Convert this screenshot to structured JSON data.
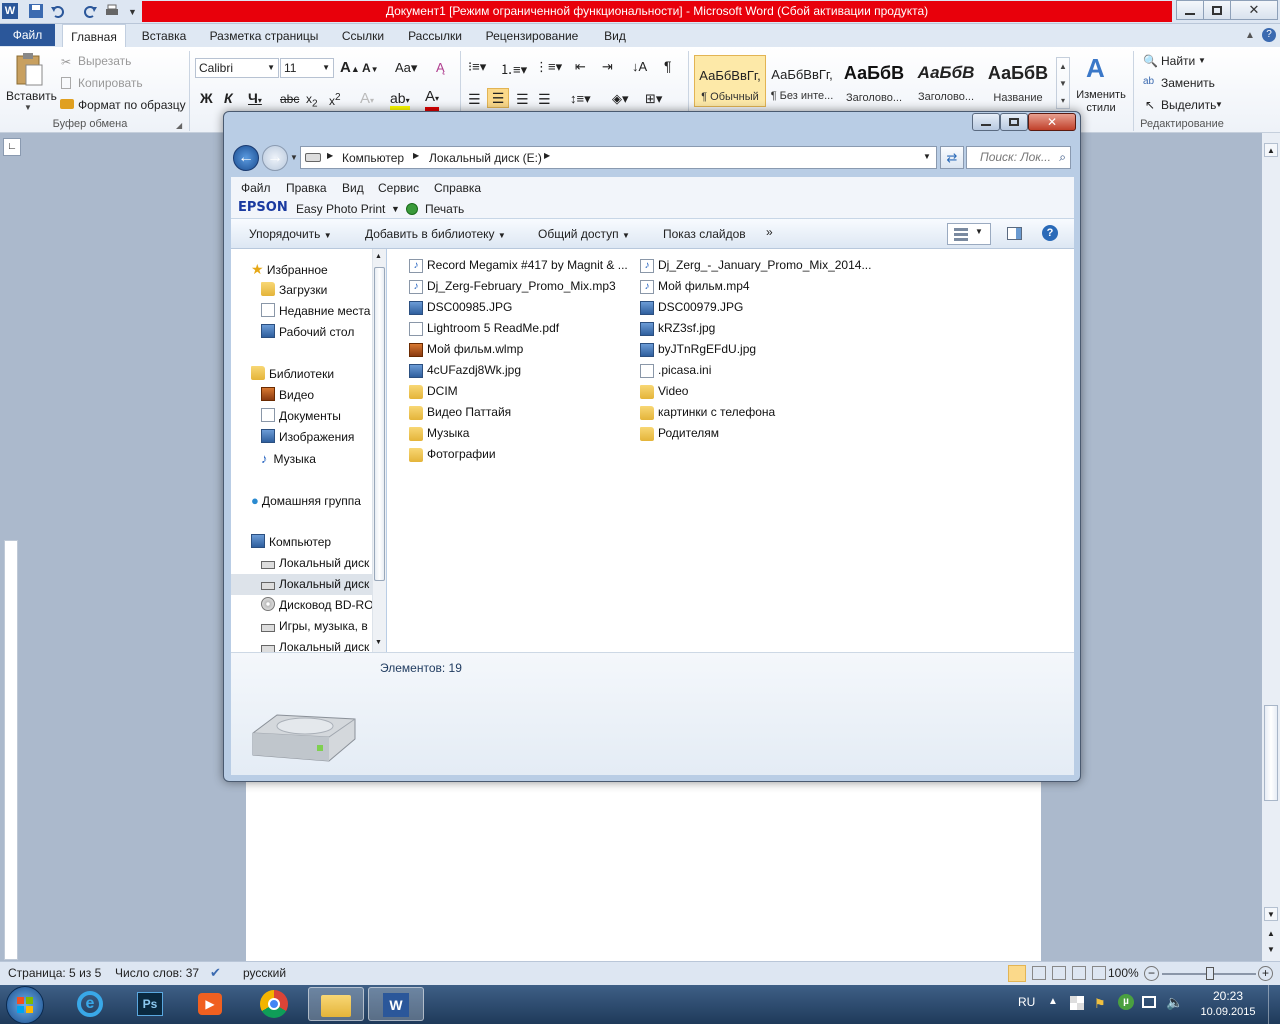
{
  "word": {
    "title": "Документ1 [Режим ограниченной функциональности]  -  Microsoft Word (Сбой активации продукта)",
    "tabs": [
      "Файл",
      "Главная",
      "Вставка",
      "Разметка страницы",
      "Ссылки",
      "Рассылки",
      "Рецензирование",
      "Вид"
    ],
    "ribbon": {
      "clipboard": {
        "paste": "Вставить",
        "cut": "Вырезать",
        "copy": "Копировать",
        "format_painter": "Формат по образцу",
        "group": "Буфер обмена"
      },
      "font": {
        "name": "Calibri",
        "size": "11"
      },
      "styles": [
        {
          "sample": "АаБбВвГг,",
          "name": "¶ Обычный"
        },
        {
          "sample": "АаБбВвГг,",
          "name": "¶ Без инте..."
        },
        {
          "sample": "АаБбВ",
          "name": "Заголово..."
        },
        {
          "sample": "АаБбВ",
          "name": "Заголово..."
        },
        {
          "sample": "АаБбВ",
          "name": "Название"
        }
      ],
      "change_styles": "Изменить стили",
      "editing": {
        "find": "Найти",
        "replace": "Заменить",
        "select": "Выделить",
        "group": "Редактирование"
      }
    },
    "status": {
      "page": "Страница: 5 из 5",
      "words": "Число слов: 37",
      "lang": "русский",
      "zoom": "100%"
    }
  },
  "explorer": {
    "breadcrumb": [
      "Компьютер",
      "Локальный диск (E:)"
    ],
    "search_placeholder": "Поиск: Лок...",
    "menu": [
      "Файл",
      "Правка",
      "Вид",
      "Сервис",
      "Справка"
    ],
    "epson": {
      "brand": "EPSON",
      "app": "Easy Photo Print",
      "print": "Печать"
    },
    "commands": [
      "Упорядочить",
      "Добавить в библиотеку",
      "Общий доступ",
      "Показ слайдов"
    ],
    "nav": {
      "favorites": "Избранное",
      "fav_items": [
        "Загрузки",
        "Недавние места",
        "Рабочий стол"
      ],
      "libraries": "Библиотеки",
      "lib_items": [
        "Видео",
        "Документы",
        "Изображения",
        "Музыка"
      ],
      "homegroup": "Домашняя группа",
      "computer": "Компьютер",
      "comp_items": [
        "Локальный диск",
        "Локальный диск",
        "Дисковод BD-RO",
        "Игры, музыка, в",
        "Локальный диск"
      ]
    },
    "files_col1": [
      {
        "name": "Record Megamix #417 by Magnit & ...",
        "icon": "audio"
      },
      {
        "name": "Dj_Zerg-February_Promo_Mix.mp3",
        "icon": "audio"
      },
      {
        "name": "DSC00985.JPG",
        "icon": "image"
      },
      {
        "name": "Lightroom 5 ReadMe.pdf",
        "icon": "doc"
      },
      {
        "name": "Мой фильм.wlmp",
        "icon": "video"
      },
      {
        "name": "4cUFazdj8Wk.jpg",
        "icon": "image"
      },
      {
        "name": "DCIM",
        "icon": "folder"
      },
      {
        "name": "Видео Паттайя",
        "icon": "folder"
      },
      {
        "name": "Музыка",
        "icon": "folder"
      },
      {
        "name": "Фотографии",
        "icon": "folder"
      }
    ],
    "files_col2": [
      {
        "name": "Dj_Zerg_-_January_Promo_Mix_2014...",
        "icon": "audio"
      },
      {
        "name": "Мой фильм.mp4",
        "icon": "audio"
      },
      {
        "name": "DSC00979.JPG",
        "icon": "image"
      },
      {
        "name": "kRZ3sf.jpg",
        "icon": "image"
      },
      {
        "name": "byJTnRgEFdU.jpg",
        "icon": "image"
      },
      {
        "name": ".picasa.ini",
        "icon": "doc"
      },
      {
        "name": "Video",
        "icon": "folder"
      },
      {
        "name": "картинки с  телефона",
        "icon": "folder"
      },
      {
        "name": "Родителям",
        "icon": "folder"
      }
    ],
    "item_count": "Элементов: 19"
  },
  "taskbar": {
    "lang": "RU",
    "time": "20:23",
    "date": "10.09.2015"
  }
}
